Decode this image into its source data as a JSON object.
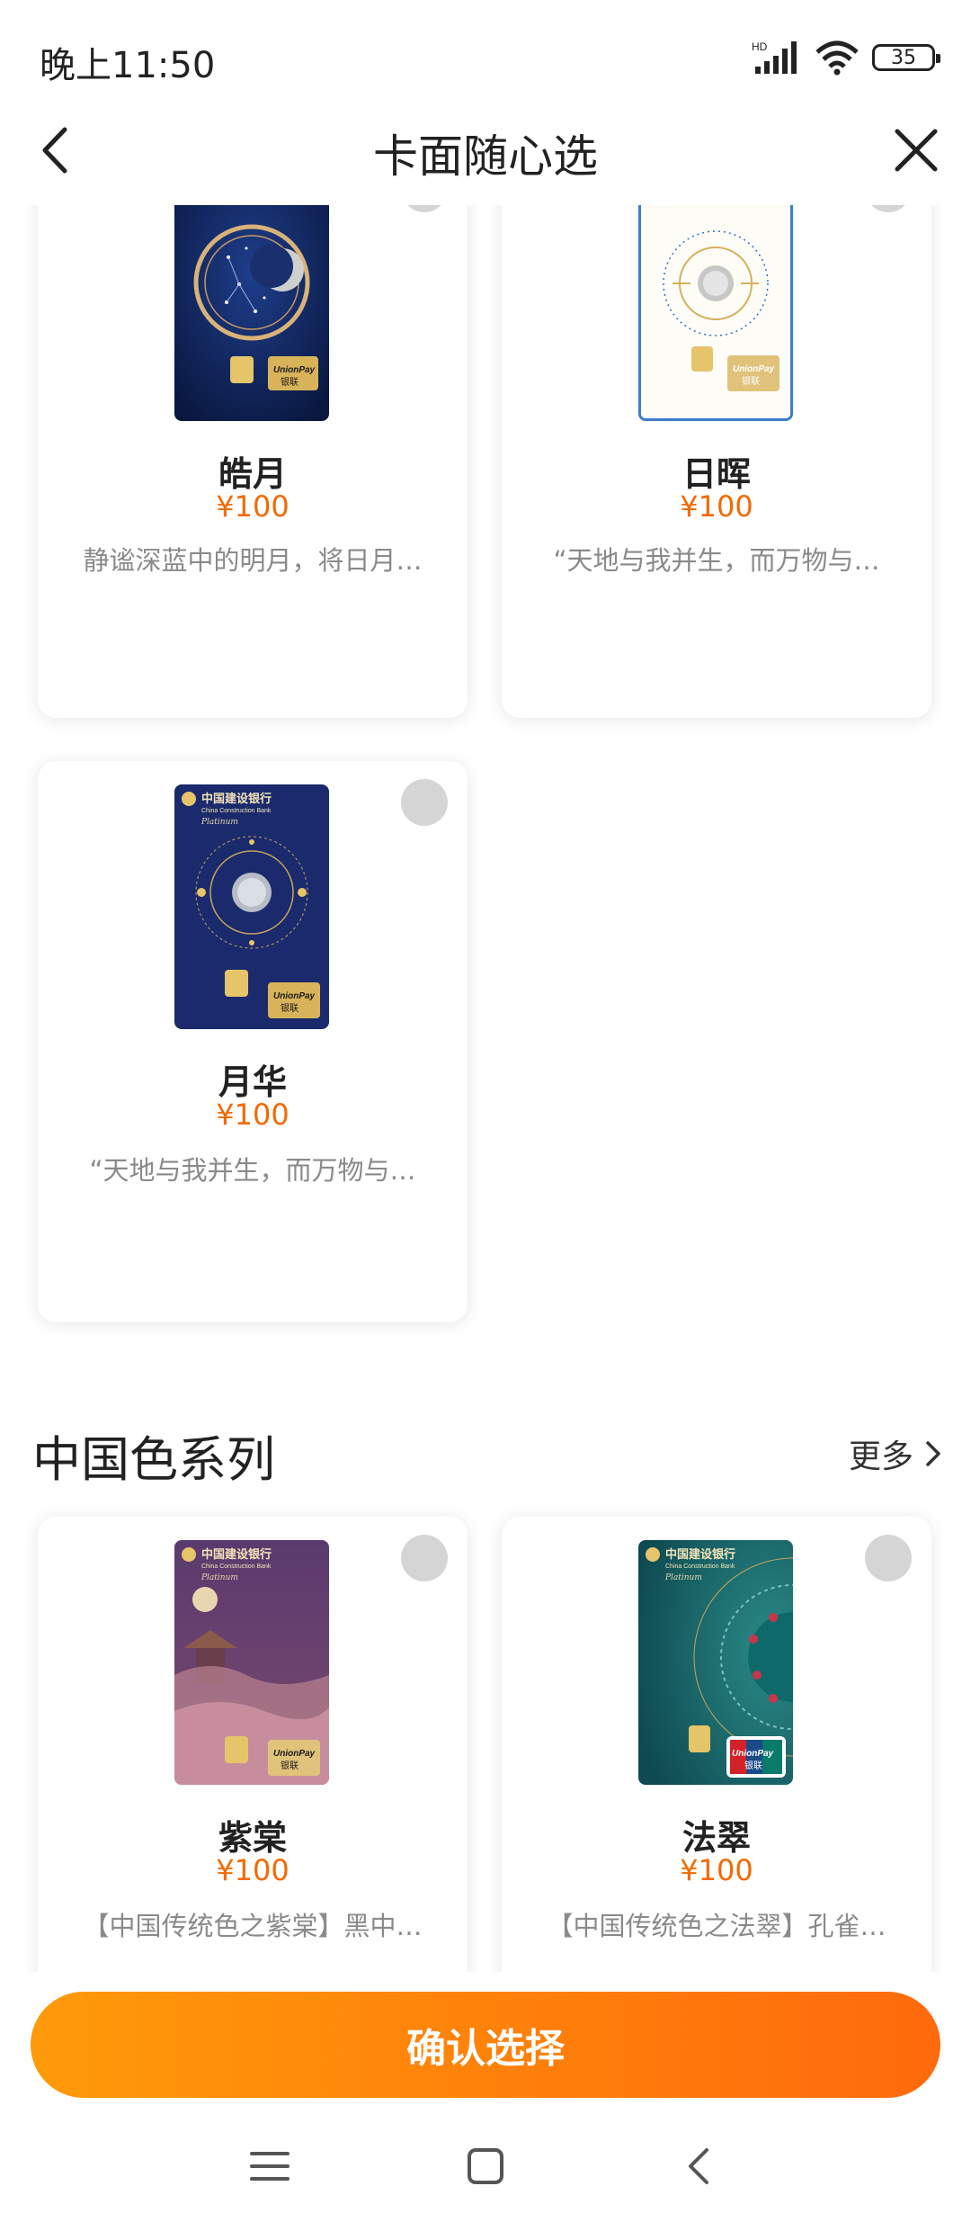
{
  "status_bar": {
    "time": "晚上11:50",
    "battery": "35",
    "icons": [
      "hd-signal-icon",
      "wifi-icon",
      "battery-icon"
    ]
  },
  "nav": {
    "title": "卡面随心选",
    "back_icon": "chevron-left-icon",
    "close_icon": "close-icon"
  },
  "cards_top": [
    {
      "name": "皓月",
      "price": "¥100",
      "desc": "静谧深蓝中的明月，将日月…"
    },
    {
      "name": "日晖",
      "price": "¥100",
      "desc": "“天地与我并生，而万物与…"
    },
    {
      "name": "月华",
      "price": "¥100",
      "desc": "“天地与我并生，而万物与…"
    }
  ],
  "section": {
    "title": "中国色系列",
    "more": "更多"
  },
  "cards_section": [
    {
      "name": "紫棠",
      "price": "¥100",
      "desc": "【中国传统色之紫棠】黑中…"
    },
    {
      "name": "法翠",
      "price": "¥100",
      "desc": "【中国传统色之法翠】孔雀…"
    }
  ],
  "confirm_label": "确认选择",
  "card_texts": {
    "bank": "中国建设银行",
    "bank_en": "China Construction Bank",
    "tier": "Platinum",
    "unionpay": "UnionPay",
    "unionpay_cn": "银联"
  },
  "colors": {
    "accent": "#f26a00",
    "button_start": "#ff9a0a",
    "button_end": "#ff6a0c"
  }
}
